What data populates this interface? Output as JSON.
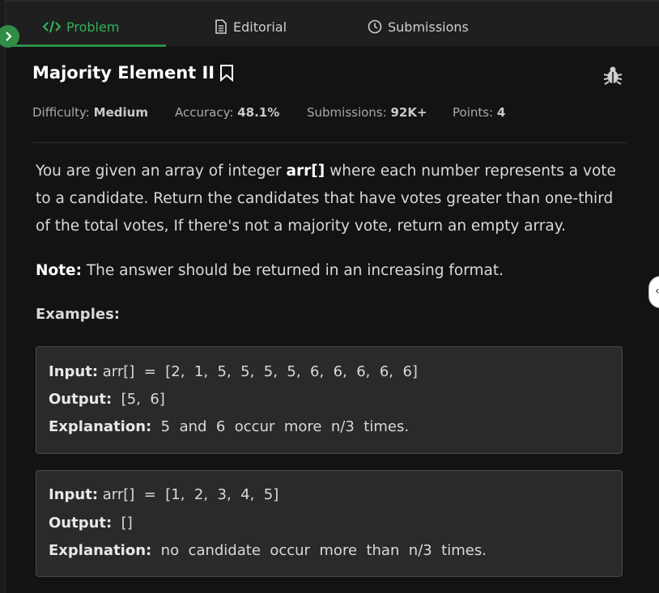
{
  "tabs": [
    {
      "label": "Problem",
      "icon": "code-icon",
      "active": true
    },
    {
      "label": "Editorial",
      "icon": "document-icon",
      "active": false
    },
    {
      "label": "Submissions",
      "icon": "clock-icon",
      "active": false
    }
  ],
  "problem": {
    "title": "Majority Element II",
    "meta": {
      "difficulty_label": "Difficulty:",
      "difficulty": "Medium",
      "accuracy_label": "Accuracy:",
      "accuracy": "48.1%",
      "submissions_label": "Submissions:",
      "submissions": "92K+",
      "points_label": "Points:",
      "points": "4"
    },
    "description": {
      "part1": "You are given an array of integer ",
      "code": "arr[]",
      "part2": " where each number represents a vote to a candidate. Return the candidates that have votes greater than one-third of the total votes, If there's not a majority vote, return an empty array."
    },
    "note": {
      "label": "Note:",
      "text": " The answer should be returned in an increasing format."
    },
    "examples_label": "Examples:",
    "examples": [
      {
        "input_label": "Input:",
        "input": " arr[]  =  [2,  1,  5,  5,  5,  5,  6,  6,  6,  6,  6]",
        "output_label": "Output:",
        "output": "  [5,  6]",
        "explanation_label": "Explanation:",
        "explanation": "  5  and  6  occur  more  n/3  times."
      },
      {
        "input_label": "Input:",
        "input": " arr[]  =  [1,  2,  3,  4,  5]",
        "output_label": "Output:",
        "output": "  []",
        "explanation_label": "Explanation:",
        "explanation": "  no  candidate  occur  more  than  n/3  times."
      }
    ]
  },
  "colors": {
    "accent": "#2fb158",
    "background": "#111314",
    "topbar": "#1f1f1f",
    "example_bg": "#2a2a2a"
  }
}
